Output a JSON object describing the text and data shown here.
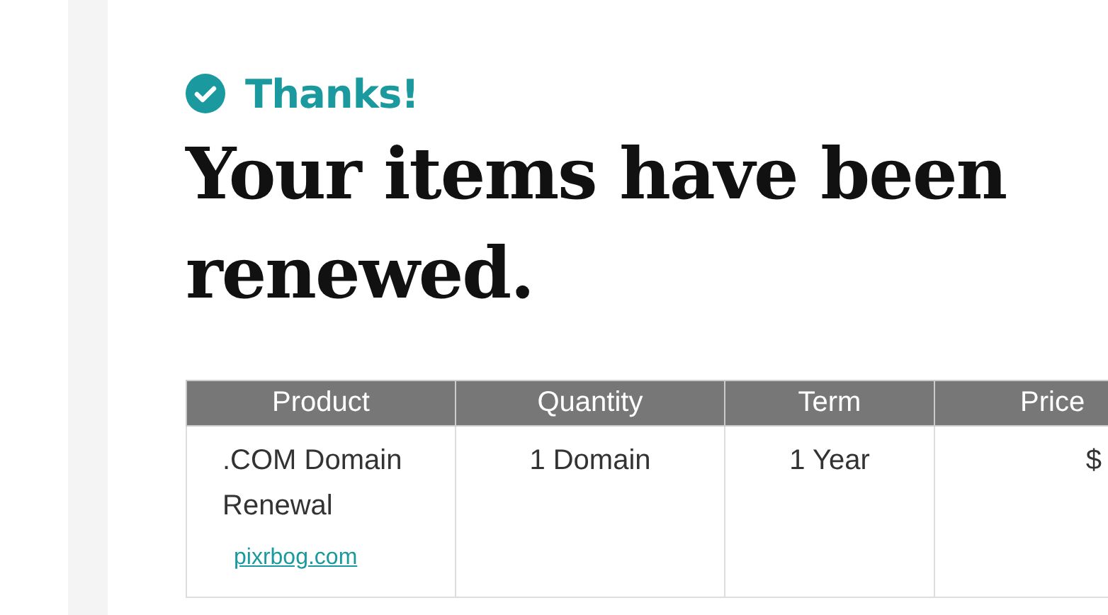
{
  "confirmation": {
    "label": "Thanks!"
  },
  "heading": "Your items have been renewed.",
  "table": {
    "columns": [
      "Product",
      "Quantity",
      "Term",
      "Price"
    ],
    "rows": [
      {
        "product": ".COM Domain Renewal",
        "domain": "pixrbog.com",
        "quantity": "1 Domain",
        "term": "1 Year",
        "price": "$"
      }
    ]
  }
}
